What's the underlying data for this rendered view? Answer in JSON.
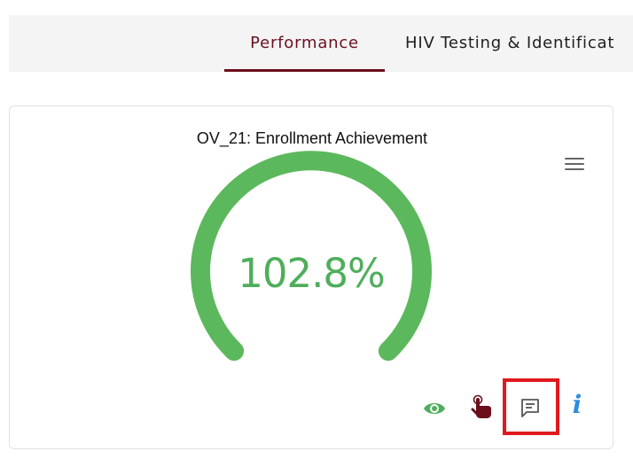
{
  "tabs": [
    {
      "label": "Performance",
      "active": true
    },
    {
      "label": "HIV Testing & Identificat",
      "active": false
    }
  ],
  "card": {
    "title": "OV_21: Enrollment Achievement",
    "gauge": {
      "value_text": "102.8%",
      "value": 102.8,
      "color": "#5cb85c"
    },
    "menu_icon": "hamburger-menu-icon",
    "actions": [
      {
        "icon": "eye-icon",
        "color": "#4fae5b"
      },
      {
        "icon": "tap-hand-icon",
        "color": "#6b0f1a"
      },
      {
        "icon": "comment-icon",
        "color": "#555555",
        "highlighted": true
      },
      {
        "icon": "info-icon",
        "label": "i",
        "color": "#2d8ee0"
      }
    ]
  },
  "colors": {
    "accent": "#6b0f1a",
    "highlight": "#e0191f"
  }
}
